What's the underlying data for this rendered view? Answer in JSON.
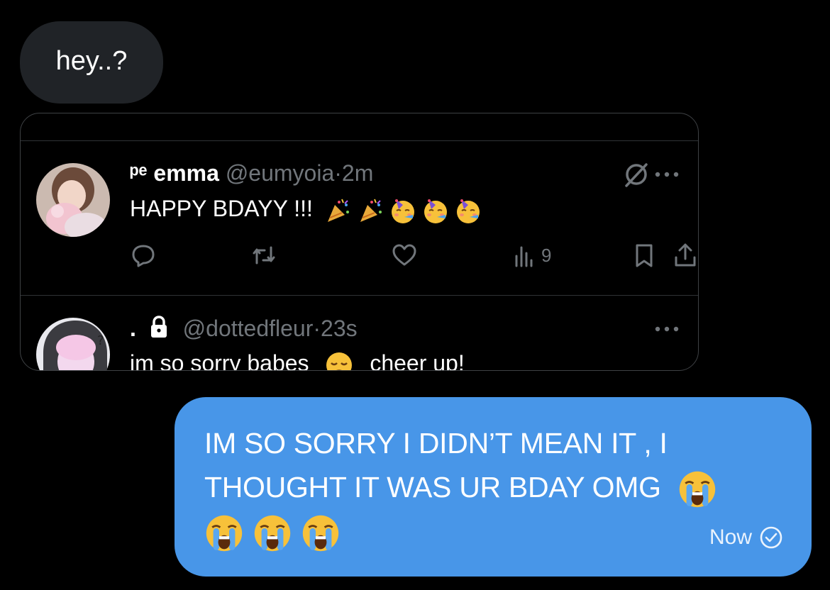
{
  "incoming_message": {
    "text": "hey..?"
  },
  "quoted_card": {
    "tweets": [
      {
        "display_name_symbol": "ᵖᵉ",
        "display_name": "emma",
        "handle": "@eumyoia",
        "separator": "·",
        "time": "2m",
        "text": "HAPPY BDAYY !!!",
        "emoji": [
          "party-popper",
          "party-popper",
          "partying-face",
          "partying-face",
          "partying-face"
        ],
        "views": "9"
      },
      {
        "display_name": ".",
        "handle": "@dottedfleur",
        "separator": "·",
        "time": "23s",
        "text_part1": "im so sorry babes",
        "text_part2": "cheer up!",
        "emoji": [
          "disappointed-face"
        ]
      }
    ]
  },
  "outgoing_message": {
    "line1": "IM SO SORRY I DIDN’T MEAN IT , I",
    "line2": "THOUGHT IT WAS UR BDAY OMG",
    "emoji": [
      "loudly-crying-face",
      "loudly-crying-face",
      "loudly-crying-face",
      "loudly-crying-face"
    ],
    "time": "Now"
  },
  "colors": {
    "background": "#000000",
    "incoming_bubble": "#202327",
    "outgoing_bubble": "#4896e8",
    "muted_text": "#71767b"
  }
}
